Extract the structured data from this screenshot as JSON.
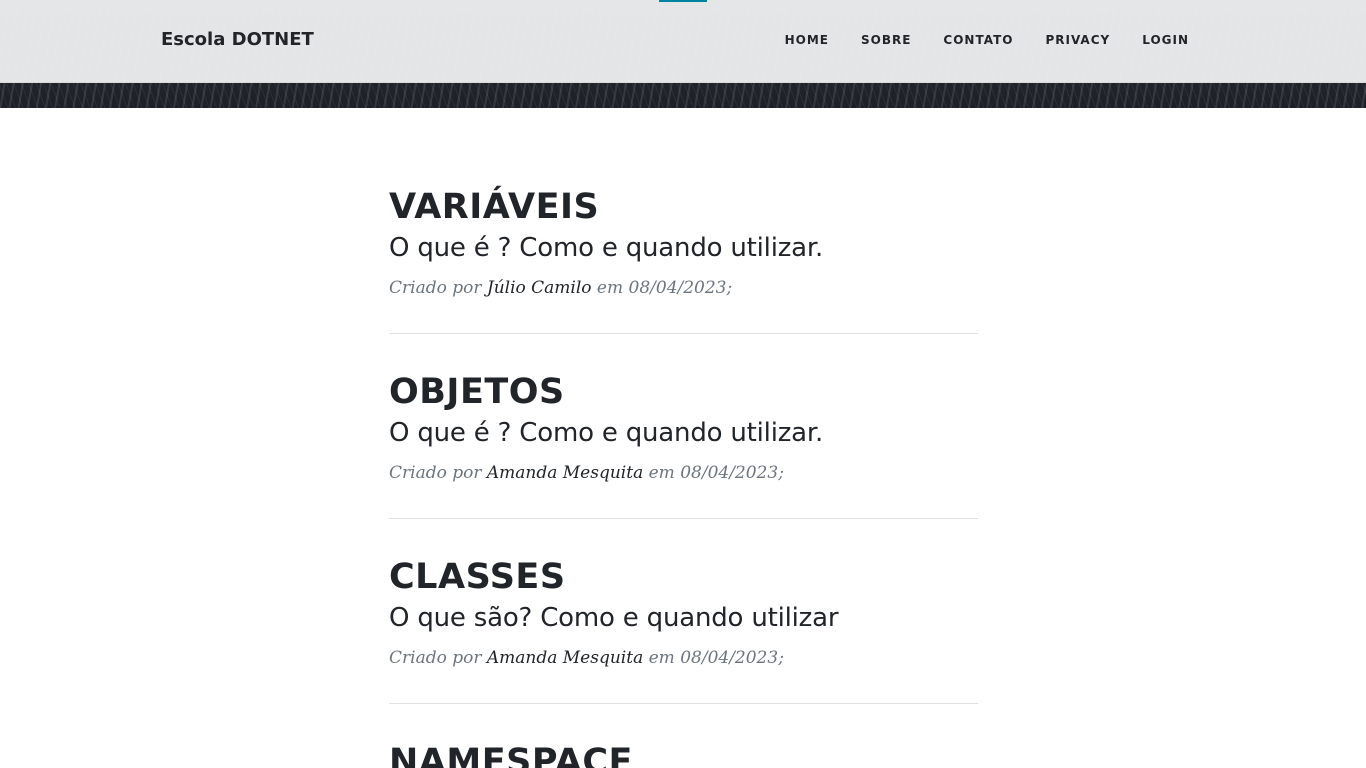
{
  "brand": "Escola DOTNET",
  "nav": [
    {
      "label": "HOME"
    },
    {
      "label": "SOBRE"
    },
    {
      "label": "CONTATO"
    },
    {
      "label": "PRIVACY"
    },
    {
      "label": "LOGIN"
    }
  ],
  "posts": [
    {
      "title": "VARIÁVEIS",
      "subtitle": "O que é ? Como e quando utilizar.",
      "meta_prefix": "Criado por ",
      "author": "Júlio Camilo",
      "meta_suffix": " em 08/04/2023;"
    },
    {
      "title": "OBJETOS",
      "subtitle": "O que é ? Como e quando utilizar.",
      "meta_prefix": "Criado por ",
      "author": "Amanda Mesquita",
      "meta_suffix": " em 08/04/2023;"
    },
    {
      "title": "CLASSES",
      "subtitle": "O que são? Como e quando utilizar",
      "meta_prefix": "Criado por ",
      "author": "Amanda Mesquita",
      "meta_suffix": " em 08/04/2023;"
    },
    {
      "title": "NAMESPACE"
    }
  ],
  "colors": {
    "text": "#212529",
    "meta": "#6c757d",
    "divider": "#dee2e6",
    "accent": "#0085a1"
  }
}
